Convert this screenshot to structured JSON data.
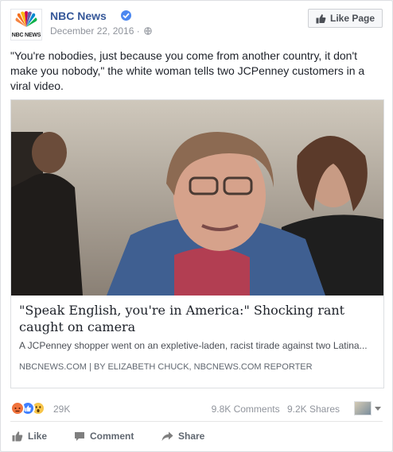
{
  "header": {
    "logo_text": "NBC NEWS",
    "page_name": "NBC News",
    "date": "December 22, 2016",
    "separator": "·",
    "like_page_label": "Like Page"
  },
  "post": {
    "caption": "\"You're nobodies, just because you come from another country, it don't make you nobody,\" the white woman tells two JCPenney customers in a viral video."
  },
  "link_card": {
    "title": "\"Speak English, you're in America:\" Shocking rant caught on camera",
    "description": "A JCPenney shopper went on an expletive-laden, racist tirade against two Latina...",
    "source": "NBCNEWS.COM",
    "source_separator": "|",
    "byline": "BY ELIZABETH CHUCK, NBCNEWS.COM REPORTER"
  },
  "reactions": {
    "count": "29K",
    "comments": "9.8K Comments",
    "shares": "9.2K Shares",
    "icons": [
      "angry-reaction-icon",
      "like-reaction-icon",
      "wow-reaction-icon"
    ]
  },
  "actions": {
    "like_label": "Like",
    "comment_label": "Comment",
    "share_label": "Share"
  },
  "colors": {
    "link_blue": "#365899",
    "verified_blue": "#4b87f0",
    "reaction_angry": "#f0733c",
    "reaction_like": "#4080ff",
    "reaction_wow": "#f7c54a"
  }
}
